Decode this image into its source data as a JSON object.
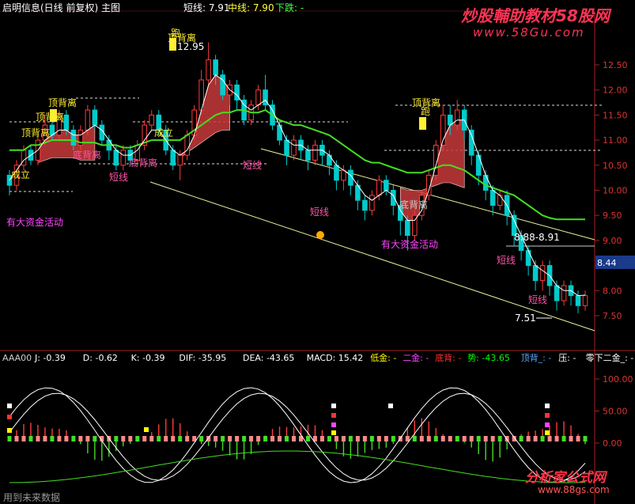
{
  "header": {
    "title": "启明信息(日线 前复权) 主图",
    "short_line": "短线: 7.91",
    "mid_line": "中线: 7.90",
    "fall_label": "下跌: -",
    "watermark_cn": "炒股輔助教材58股网",
    "watermark_url": "www.58Gu.com"
  },
  "price_axis": {
    "ticks": [
      "12.50",
      "12.00",
      "11.50",
      "11.00",
      "10.50",
      "10.00",
      "9.50",
      "9.00",
      "8.50",
      "8.00",
      "7.50"
    ],
    "current_price": "8.44"
  },
  "annotations": {
    "high_value": "12.95",
    "low_value": "7.51",
    "range_label": "8.88-8.91",
    "capital_activity_1": "有大资金活动",
    "capital_activity_2": "有大资金活动",
    "run_label": "跑",
    "top_divergence": "顶背离",
    "bottom_divergence": "底背离",
    "established": "成立",
    "short_line_label": "短线"
  },
  "indicator": {
    "legend": [
      {
        "text": "AAA00",
        "color": "#cccccc"
      },
      {
        "text": "J: -0.39",
        "color": "#ffffff"
      },
      {
        "text": "D: -0.62",
        "color": "#ffffff"
      },
      {
        "text": "K: -0.39",
        "color": "#ffffff"
      },
      {
        "text": "DIF: -35.95",
        "color": "#ffffff"
      },
      {
        "text": "DEA: -43.65",
        "color": "#ffffff"
      },
      {
        "text": "MACD: 15.42",
        "color": "#ffffff"
      },
      {
        "text": "低金: -",
        "color": "#ffff00"
      },
      {
        "text": "二金: -",
        "color": "#ff44ff"
      },
      {
        "text": "底背: -",
        "color": "#ff3333"
      },
      {
        "text": "势: -43.65",
        "color": "#00ff00"
      },
      {
        "text": "顶背_: -",
        "color": "#55aaff"
      },
      {
        "text": "压: -",
        "color": "#ffffff"
      },
      {
        "text": "零下二金_: -",
        "color": "#ffffff"
      }
    ],
    "ticks": [
      "100.00",
      "50.00",
      "0.00"
    ],
    "footer": "用到未来数据",
    "logo_text": "分析家公式网",
    "logo_url": "www.88gs.com"
  },
  "colors": {
    "up": "#ff3b3b",
    "down": "#00cccc",
    "mid_line": "#44dd22",
    "short_line": "#ffffff",
    "band": "#c83a3a",
    "axis": "#aa1f1f",
    "trend": "#eeee99",
    "label_pink": "#ff55aa",
    "label_yellow": "#ffee33",
    "label_magenta": "#ff44ff"
  },
  "chart_data": {
    "type": "candlestick",
    "title": "启明信息(日线 前复权) 主图",
    "ylim": [
      7.3,
      12.8
    ],
    "candles": [
      [
        10.3,
        10.1,
        10.4,
        9.9
      ],
      [
        10.1,
        10.5,
        10.6,
        10.0
      ],
      [
        10.5,
        10.8,
        10.9,
        10.4
      ],
      [
        10.8,
        10.6,
        10.9,
        10.5
      ],
      [
        10.6,
        11.0,
        11.1,
        10.5
      ],
      [
        11.0,
        11.3,
        11.5,
        10.9
      ],
      [
        11.3,
        11.1,
        11.4,
        11.0
      ],
      [
        11.1,
        11.5,
        11.6,
        11.0
      ],
      [
        11.5,
        11.2,
        11.6,
        11.1
      ],
      [
        11.2,
        10.9,
        11.3,
        10.8
      ],
      [
        10.9,
        11.2,
        11.3,
        10.8
      ],
      [
        11.2,
        11.6,
        11.7,
        11.1
      ],
      [
        11.6,
        11.3,
        11.7,
        11.2
      ],
      [
        11.3,
        11.0,
        11.4,
        10.9
      ],
      [
        11.0,
        10.8,
        11.1,
        10.6
      ],
      [
        10.8,
        10.5,
        10.9,
        10.4
      ],
      [
        10.5,
        10.8,
        10.9,
        10.4
      ],
      [
        10.8,
        10.6,
        10.9,
        10.5
      ],
      [
        10.6,
        10.9,
        11.0,
        10.5
      ],
      [
        10.9,
        11.3,
        11.4,
        10.8
      ],
      [
        11.3,
        11.5,
        11.6,
        11.2
      ],
      [
        11.5,
        11.2,
        11.6,
        11.1
      ],
      [
        11.2,
        10.8,
        11.3,
        10.7
      ],
      [
        10.8,
        10.5,
        10.9,
        10.4
      ],
      [
        10.5,
        10.7,
        10.8,
        10.2
      ],
      [
        10.7,
        11.1,
        11.2,
        10.6
      ],
      [
        11.1,
        11.6,
        11.7,
        11.0
      ],
      [
        11.6,
        12.2,
        12.4,
        11.5
      ],
      [
        12.2,
        12.6,
        12.95,
        12.1
      ],
      [
        12.6,
        12.3,
        12.7,
        12.1
      ],
      [
        12.3,
        11.9,
        12.4,
        11.8
      ],
      [
        11.9,
        12.1,
        12.2,
        11.7
      ],
      [
        12.1,
        11.8,
        12.2,
        11.6
      ],
      [
        11.8,
        11.4,
        11.9,
        11.3
      ],
      [
        11.4,
        11.7,
        11.8,
        11.3
      ],
      [
        11.7,
        12.0,
        12.1,
        11.6
      ],
      [
        12.0,
        11.7,
        12.3,
        11.6
      ],
      [
        11.7,
        11.3,
        11.8,
        11.2
      ],
      [
        11.3,
        11.0,
        11.4,
        10.9
      ],
      [
        11.0,
        10.7,
        11.1,
        10.5
      ],
      [
        10.7,
        11.0,
        11.1,
        10.6
      ],
      [
        11.0,
        10.8,
        11.1,
        10.6
      ],
      [
        10.8,
        10.6,
        10.9,
        10.4
      ],
      [
        10.6,
        10.9,
        11.0,
        10.5
      ],
      [
        10.9,
        10.7,
        11.0,
        10.5
      ],
      [
        10.7,
        10.5,
        10.8,
        10.3
      ],
      [
        10.5,
        10.2,
        10.6,
        10.0
      ],
      [
        10.2,
        10.4,
        10.5,
        10.0
      ],
      [
        10.4,
        10.1,
        10.5,
        9.9
      ],
      [
        10.1,
        9.8,
        10.2,
        9.6
      ],
      [
        9.8,
        9.6,
        9.9,
        9.4
      ],
      [
        9.6,
        9.9,
        10.0,
        9.5
      ],
      [
        9.9,
        10.2,
        10.3,
        9.8
      ],
      [
        10.2,
        10.0,
        10.3,
        9.9
      ],
      [
        10.0,
        9.7,
        10.1,
        9.5
      ],
      [
        9.7,
        9.4,
        9.8,
        9.1
      ],
      [
        9.4,
        9.1,
        9.5,
        8.8
      ],
      [
        9.1,
        9.5,
        9.6,
        9.0
      ],
      [
        9.5,
        9.9,
        10.0,
        9.4
      ],
      [
        9.9,
        10.3,
        10.4,
        9.8
      ],
      [
        10.3,
        10.9,
        11.0,
        10.2
      ],
      [
        10.9,
        11.5,
        11.7,
        10.8
      ],
      [
        11.5,
        11.3,
        11.7,
        11.1
      ],
      [
        11.3,
        11.6,
        11.8,
        11.2
      ],
      [
        11.6,
        11.2,
        11.7,
        11.0
      ],
      [
        11.2,
        10.7,
        11.3,
        10.5
      ],
      [
        10.7,
        10.3,
        10.8,
        10.1
      ],
      [
        10.3,
        10.0,
        10.4,
        9.8
      ],
      [
        10.0,
        9.7,
        10.1,
        9.5
      ],
      [
        9.7,
        9.9,
        10.0,
        9.6
      ],
      [
        9.9,
        9.5,
        10.0,
        9.3
      ],
      [
        9.5,
        9.1,
        9.6,
        8.9
      ],
      [
        9.1,
        8.8,
        9.2,
        8.6
      ],
      [
        8.8,
        8.5,
        8.9,
        8.3
      ],
      [
        8.5,
        8.2,
        8.6,
        8.0
      ],
      [
        8.2,
        8.5,
        8.6,
        8.0
      ],
      [
        8.5,
        8.1,
        8.6,
        7.9
      ],
      [
        8.1,
        7.8,
        8.2,
        7.6
      ],
      [
        7.8,
        8.1,
        8.2,
        7.7
      ],
      [
        8.1,
        7.9,
        8.2,
        7.7
      ],
      [
        7.9,
        7.7,
        8.0,
        7.55
      ],
      [
        7.7,
        7.9,
        8.0,
        7.6
      ]
    ],
    "short_line": [
      10.2,
      10.4,
      10.6,
      10.7,
      10.8,
      11.0,
      11.1,
      11.2,
      11.2,
      11.1,
      11.1,
      11.2,
      11.3,
      11.2,
      11.0,
      10.8,
      10.7,
      10.7,
      10.8,
      11.0,
      11.2,
      11.2,
      11.0,
      10.8,
      10.7,
      10.8,
      11.1,
      11.6,
      12.1,
      12.3,
      12.2,
      12.0,
      11.9,
      11.7,
      11.6,
      11.7,
      11.8,
      11.6,
      11.3,
      11.0,
      10.9,
      10.9,
      10.8,
      10.8,
      10.8,
      10.7,
      10.5,
      10.4,
      10.3,
      10.1,
      9.9,
      9.8,
      9.9,
      10.0,
      9.9,
      9.6,
      9.4,
      9.4,
      9.6,
      10.0,
      10.5,
      11.0,
      11.3,
      11.4,
      11.4,
      11.1,
      10.7,
      10.3,
      10.0,
      9.9,
      9.7,
      9.4,
      9.1,
      8.8,
      8.5,
      8.4,
      8.3,
      8.1,
      8.0,
      8.0,
      7.9,
      7.91
    ],
    "mid_line": [
      10.8,
      10.8,
      10.8,
      10.9,
      10.9,
      10.95,
      11.0,
      11.0,
      11.0,
      11.0,
      10.95,
      10.95,
      10.95,
      10.9,
      10.9,
      10.9,
      10.85,
      10.85,
      10.9,
      10.95,
      11.0,
      11.0,
      11.0,
      11.0,
      11.0,
      11.1,
      11.2,
      11.3,
      11.4,
      11.5,
      11.55,
      11.55,
      11.6,
      11.6,
      11.55,
      11.55,
      11.6,
      11.5,
      11.4,
      11.35,
      11.3,
      11.3,
      11.25,
      11.2,
      11.15,
      11.1,
      11.0,
      10.9,
      10.8,
      10.7,
      10.6,
      10.55,
      10.55,
      10.5,
      10.45,
      10.4,
      10.35,
      10.35,
      10.35,
      10.4,
      10.45,
      10.5,
      10.5,
      10.45,
      10.4,
      10.3,
      10.2,
      10.1,
      10.05,
      10.0,
      9.95,
      9.9,
      9.8,
      9.7,
      9.6,
      9.5,
      9.45,
      9.42,
      9.42,
      9.42,
      9.42,
      9.42
    ]
  }
}
